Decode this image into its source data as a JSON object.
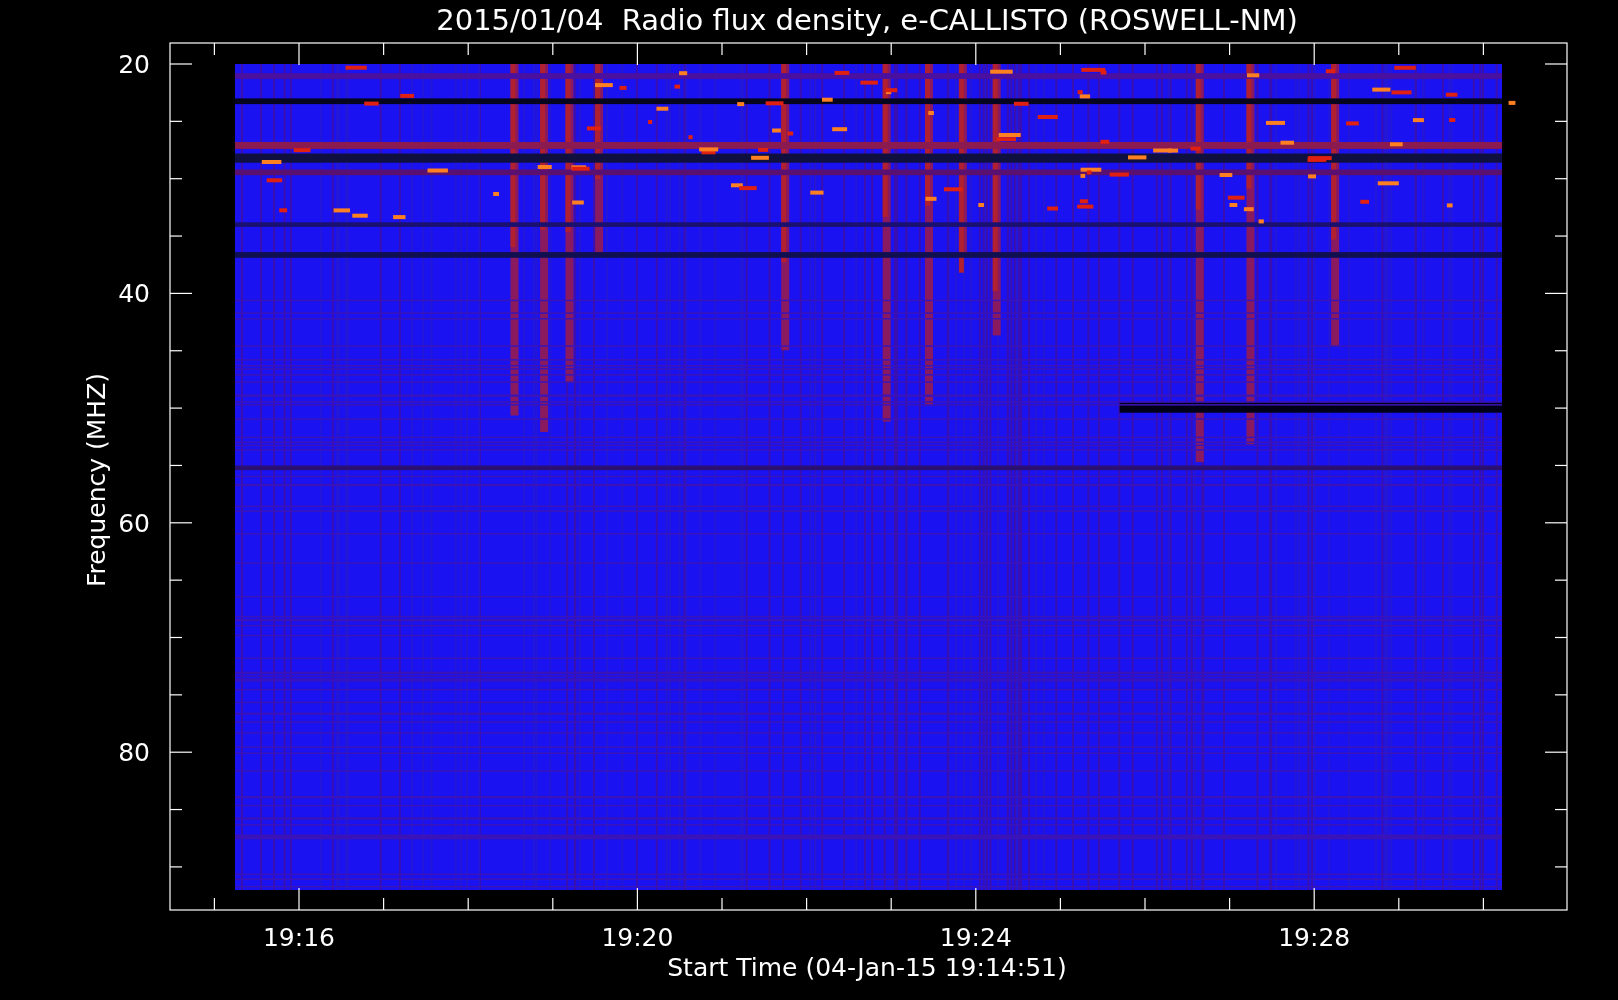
{
  "plot": {
    "title": "2015/01/04  Radio flux density, e-CALLISTO (ROSWELL-NM)",
    "xlabel": "Start Time (04-Jan-15 19:14:51)",
    "ylabel": "Frequency (MHZ)",
    "y_tick_labels": [
      "20",
      "40",
      "60",
      "80"
    ],
    "x_tick_labels": [
      "19:16",
      "19:20",
      "19:24",
      "19:28"
    ]
  }
}
